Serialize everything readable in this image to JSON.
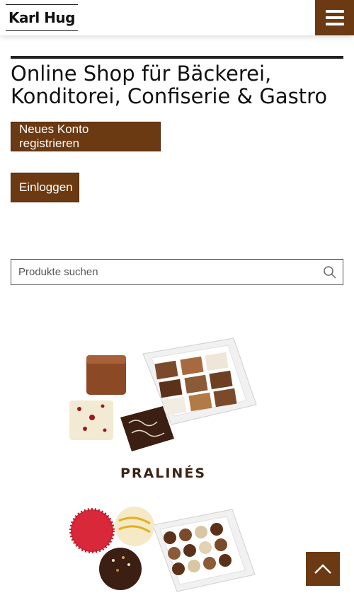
{
  "header": {
    "logo_text": "Karl Hug",
    "menu_icon": "hamburger-icon"
  },
  "main": {
    "title": "Online Shop für Bäckerei, Konditorei, Confiserie & Gastro",
    "register_label": "Neues Konto registrieren",
    "login_label": "Einloggen"
  },
  "search": {
    "placeholder": "Produkte suchen",
    "icon": "search-icon"
  },
  "categories": [
    {
      "label": "PRALINÉS"
    },
    {
      "label": ""
    }
  ],
  "scroll_top_icon": "chevron-up-icon",
  "colors": {
    "brand": "#6b3a12",
    "text": "#111111"
  }
}
